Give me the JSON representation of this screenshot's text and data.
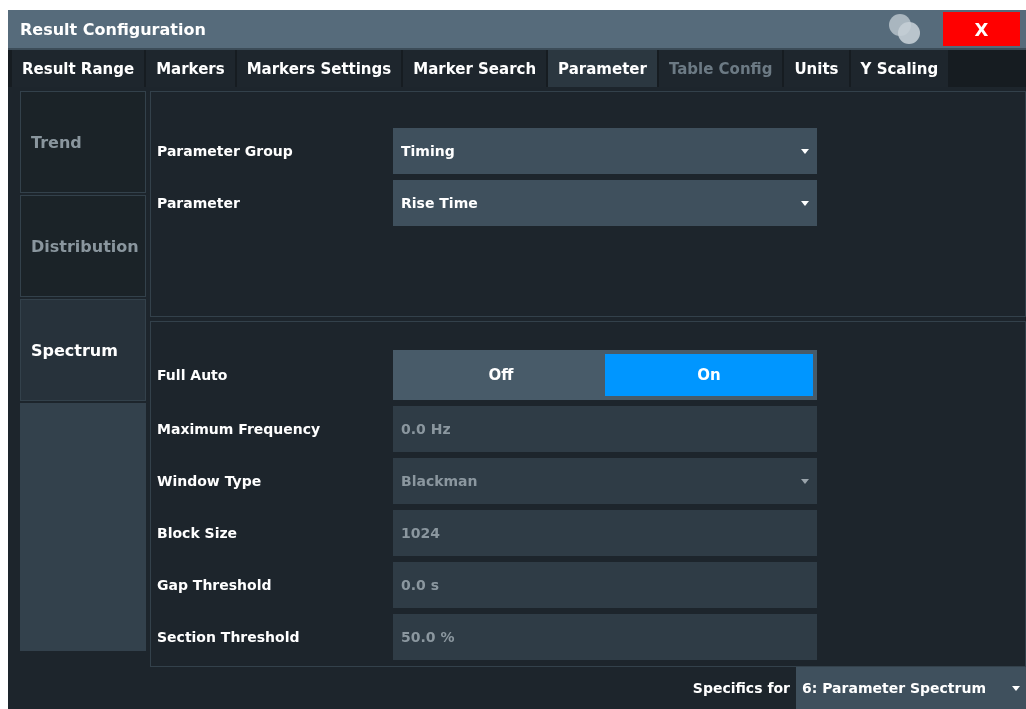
{
  "window": {
    "title": "Result Configuration",
    "close_label": "X"
  },
  "tabs": [
    {
      "label": "Result Range",
      "selected": false,
      "disabled": false
    },
    {
      "label": "Markers",
      "selected": false,
      "disabled": false
    },
    {
      "label": "Markers Settings",
      "selected": false,
      "disabled": false
    },
    {
      "label": "Marker Search",
      "selected": false,
      "disabled": false
    },
    {
      "label": "Parameter",
      "selected": true,
      "disabled": false
    },
    {
      "label": "Table Config",
      "selected": false,
      "disabled": true
    },
    {
      "label": "Units",
      "selected": false,
      "disabled": false
    },
    {
      "label": "Y Scaling",
      "selected": false,
      "disabled": false
    }
  ],
  "side_tabs": [
    {
      "label": "Trend",
      "selected": false
    },
    {
      "label": "Distribution",
      "selected": false
    },
    {
      "label": "Spectrum",
      "selected": true
    }
  ],
  "parameter_section": [
    {
      "label": "Parameter Group",
      "kind": "dropdown",
      "value": "Timing",
      "disabled": false
    },
    {
      "label": "Parameter",
      "kind": "dropdown",
      "value": "Rise Time",
      "disabled": false
    }
  ],
  "spectrum_section": [
    {
      "label": "Full Auto",
      "kind": "toggle",
      "options": [
        {
          "label": "Off",
          "selected": false
        },
        {
          "label": "On",
          "selected": true
        }
      ]
    },
    {
      "label": "Maximum Frequency",
      "kind": "input",
      "value": "0.0 Hz",
      "disabled": true
    },
    {
      "label": "Window Type",
      "kind": "dropdown",
      "value": "Blackman",
      "disabled": true
    },
    {
      "label": "Block Size",
      "kind": "input",
      "value": "1024",
      "disabled": true
    },
    {
      "label": "Gap Threshold",
      "kind": "input",
      "value": "0.0 s",
      "disabled": true
    },
    {
      "label": "Section Threshold",
      "kind": "input",
      "value": "50.0 %",
      "disabled": true
    }
  ],
  "footer": {
    "label": "Specifics for",
    "value": "6: Parameter Spectrum"
  }
}
